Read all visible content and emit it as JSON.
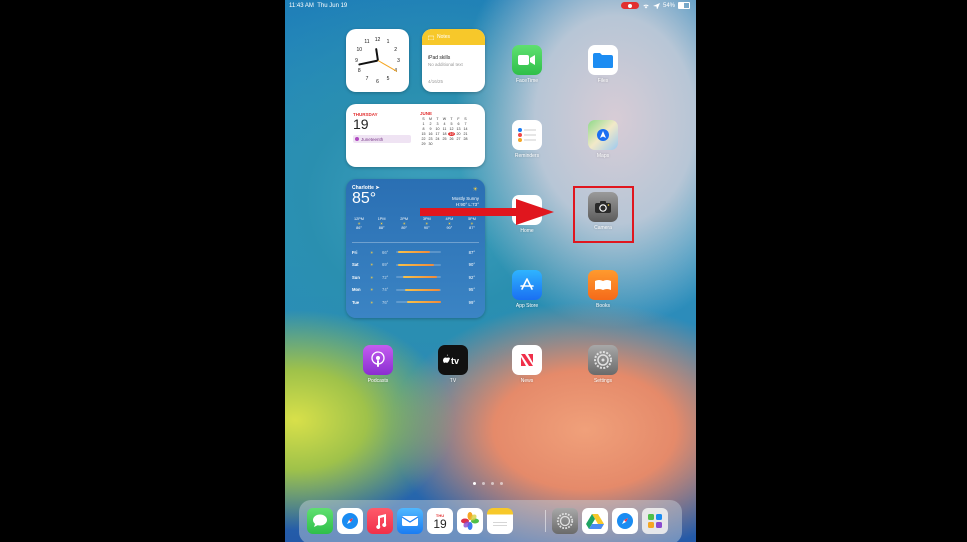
{
  "status": {
    "time": "11:43 AM",
    "date": "Thu Jun 19",
    "battery": "54%",
    "battery_level": 0.54
  },
  "clock_widget": {
    "numbers": [
      "12",
      "1",
      "2",
      "3",
      "4",
      "5",
      "6",
      "7",
      "8",
      "9",
      "10",
      "11"
    ]
  },
  "notes_widget": {
    "header": "Notes",
    "title": "iPad skills",
    "subtitle": "No additional text",
    "date": "4/16/25"
  },
  "calendar_widget": {
    "weekday": "THURSDAY",
    "day": "19",
    "event": "Juneteenth",
    "month": "JUNE",
    "weekday_letters": [
      "S",
      "M",
      "T",
      "W",
      "T",
      "F",
      "S"
    ],
    "days": [
      "1",
      "2",
      "3",
      "4",
      "5",
      "6",
      "7",
      "8",
      "9",
      "10",
      "11",
      "12",
      "13",
      "14",
      "15",
      "16",
      "17",
      "18",
      "19",
      "20",
      "21",
      "22",
      "23",
      "24",
      "25",
      "26",
      "27",
      "28",
      "29",
      "30"
    ],
    "today": "19"
  },
  "weather_widget": {
    "city": "Charlotte",
    "temp": "85°",
    "condition": "Mostly Sunny",
    "high_low": "H:90° L:73°",
    "hourly": [
      {
        "time": "12PM",
        "temp": "86°"
      },
      {
        "time": "1PM",
        "temp": "88°"
      },
      {
        "time": "2PM",
        "temp": "89°"
      },
      {
        "time": "3PM",
        "temp": "90°"
      },
      {
        "time": "4PM",
        "temp": "90°"
      },
      {
        "time": "5PM",
        "temp": "87°"
      }
    ],
    "daily": [
      {
        "day": "Fri",
        "low": "66°",
        "high": "87°",
        "bar_start": 0.05,
        "bar_end": 0.75
      },
      {
        "day": "Sat",
        "low": "69°",
        "high": "90°",
        "bar_start": 0.05,
        "bar_end": 0.85
      },
      {
        "day": "Sun",
        "low": "72°",
        "high": "92°",
        "bar_start": 0.15,
        "bar_end": 0.9
      },
      {
        "day": "Mon",
        "low": "74°",
        "high": "95°",
        "bar_start": 0.2,
        "bar_end": 0.97
      },
      {
        "day": "Tue",
        "low": "76°",
        "high": "99°",
        "bar_start": 0.25,
        "bar_end": 1.0
      }
    ]
  },
  "apps": {
    "facetime": "FaceTime",
    "files": "Files",
    "reminders": "Reminders",
    "maps": "Maps",
    "home": "Home",
    "camera": "Camera",
    "app_store": "App Store",
    "books": "Books",
    "podcasts": "Podcasts",
    "tv": "TV",
    "news": "News",
    "settings": "Settings"
  },
  "dock": {
    "calendar_weekday": "THU",
    "calendar_day": "19"
  },
  "colors": {
    "highlight": "#e0161e",
    "arrow": "#e0161e"
  }
}
